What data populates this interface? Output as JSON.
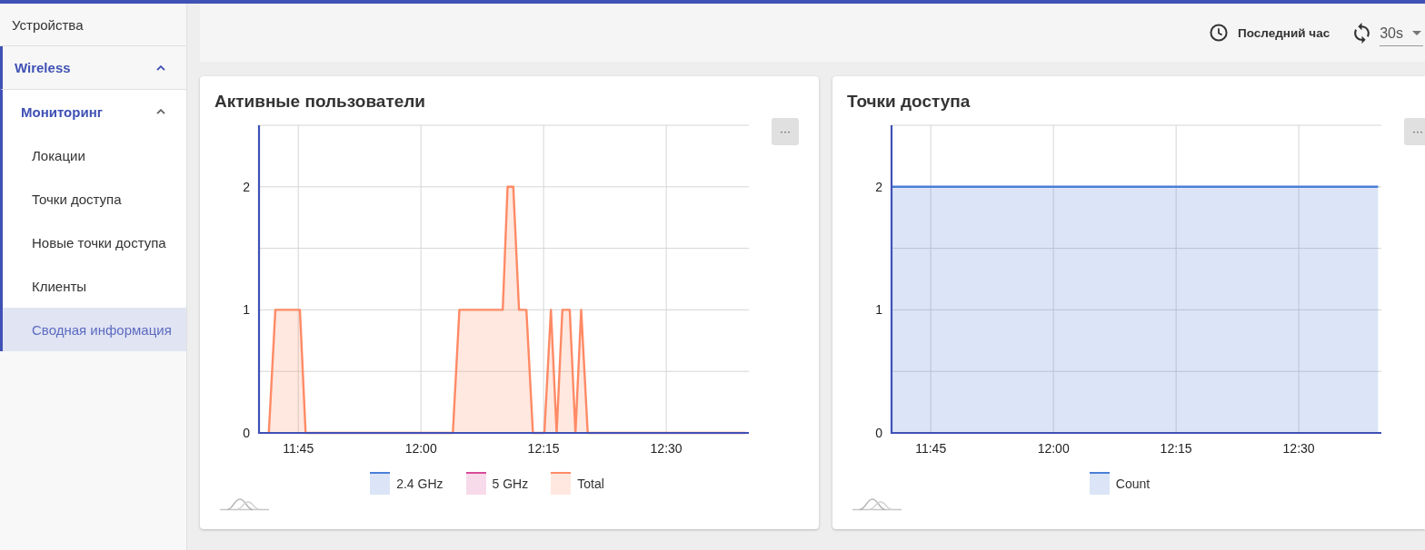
{
  "top_bar": {
    "time_range": "Последний час",
    "refresh_interval": "30s"
  },
  "sidebar": {
    "items": [
      {
        "label": "Устройства",
        "selected": false
      },
      {
        "label": "Wireless",
        "selected": false,
        "expanded": true,
        "children": [
          {
            "label": "Мониторинг",
            "selected": false,
            "expanded": true,
            "children": [
              {
                "label": "Локации",
                "selected": false
              },
              {
                "label": "Точки доступа",
                "selected": false
              },
              {
                "label": "Новые точки доступа",
                "selected": false
              },
              {
                "label": "Клиенты",
                "selected": false
              },
              {
                "label": "Сводная информация",
                "selected": true
              }
            ]
          }
        ]
      }
    ]
  },
  "cards": [
    {
      "title": "Активные пользователи",
      "menu_button": "···",
      "chart_data": {
        "type": "area",
        "x": [
          701.4,
          702.2,
          704.4,
          705.2,
          705.9,
          723.9,
          724.7,
          730.0,
          730.6,
          731.3,
          732.0,
          732.9,
          733.7,
          735.1,
          735.9,
          736.6,
          737.3,
          738.2,
          738.9,
          739.6,
          740.4,
          759.7
        ],
        "series": [
          {
            "name": "2.4 GHz",
            "color": "#4a7fd6",
            "values": [
              null,
              null,
              null,
              null,
              null,
              null,
              null,
              null,
              null,
              null,
              null,
              null,
              null,
              null,
              null,
              null,
              null,
              null,
              null,
              null,
              null,
              null
            ]
          },
          {
            "name": "5 GHz",
            "color": "#d94a97",
            "values": [
              null,
              null,
              null,
              null,
              null,
              null,
              null,
              null,
              null,
              null,
              null,
              null,
              null,
              null,
              null,
              null,
              null,
              null,
              null,
              null,
              null,
              null
            ]
          },
          {
            "name": "Total",
            "color": "#ff8a65",
            "values": [
              0,
              1,
              1,
              1,
              0,
              0,
              1,
              1,
              2,
              2,
              1,
              1,
              0,
              0,
              1,
              0,
              1,
              1,
              0,
              1,
              0,
              0
            ]
          }
        ],
        "xlim": [
          700.2,
          760.1
        ],
        "ylim": [
          0,
          2.5
        ],
        "xticks": [
          {
            "value": 705,
            "label": "11:45"
          },
          {
            "value": 720,
            "label": "12:00"
          },
          {
            "value": 735,
            "label": "12:15"
          },
          {
            "value": 750,
            "label": "12:30"
          }
        ],
        "yticks": [
          0,
          1,
          2
        ],
        "grid": true
      }
    },
    {
      "title": "Точки доступа",
      "menu_button": "···",
      "chart_data": {
        "type": "area",
        "x": [
          700.3,
          702.1,
          704.4,
          759.7
        ],
        "series": [
          {
            "name": "Count",
            "color": "#4a7fd6",
            "values": [
              2,
              2,
              2,
              2
            ]
          }
        ],
        "xlim": [
          700.2,
          760.1
        ],
        "ylim": [
          0,
          2.5
        ],
        "xticks": [
          {
            "value": 705,
            "label": "11:45"
          },
          {
            "value": 720,
            "label": "12:00"
          },
          {
            "value": 735,
            "label": "12:15"
          },
          {
            "value": 750,
            "label": "12:30"
          }
        ],
        "yticks": [
          0,
          1,
          2
        ],
        "grid": true
      }
    }
  ]
}
